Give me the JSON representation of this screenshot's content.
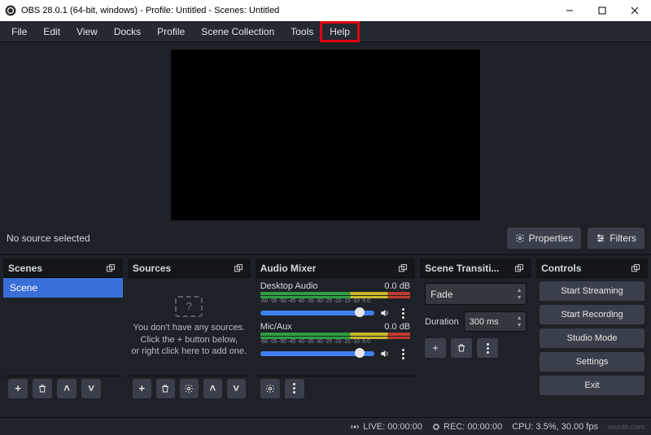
{
  "window": {
    "title": "OBS 28.0.1 (64-bit, windows) - Profile: Untitled - Scenes: Untitled"
  },
  "menu": {
    "file": "File",
    "edit": "Edit",
    "view": "View",
    "docks": "Docks",
    "profile": "Profile",
    "scene_collection": "Scene Collection",
    "tools": "Tools",
    "help": "Help"
  },
  "preview": {
    "no_source": "No source selected",
    "properties": "Properties",
    "filters": "Filters"
  },
  "scenes": {
    "title": "Scenes",
    "items": [
      "Scene"
    ]
  },
  "sources": {
    "title": "Sources",
    "hint1": "You don't have any sources.",
    "hint2": "Click the + button below,",
    "hint3": "or right click here to add one."
  },
  "mixer": {
    "title": "Audio Mixer",
    "ticks": "-60 -55 -50 -45 -40 -35 -30 -25 -20 -15 -10 -5 0",
    "channels": [
      {
        "name": "Desktop Audio",
        "level": "0.0 dB"
      },
      {
        "name": "Mic/Aux",
        "level": "0.0 dB"
      }
    ]
  },
  "transitions": {
    "title": "Scene Transiti...",
    "selected": "Fade",
    "duration_label": "Duration",
    "duration_value": "300 ms"
  },
  "controls": {
    "title": "Controls",
    "buttons": {
      "start_streaming": "Start Streaming",
      "start_recording": "Start Recording",
      "studio_mode": "Studio Mode",
      "settings": "Settings",
      "exit": "Exit"
    }
  },
  "status": {
    "live": "LIVE: 00:00:00",
    "rec": "REC: 00:00:00",
    "cpu": "CPU: 3.5%, 30.00 fps"
  },
  "icons": {
    "plus": "+",
    "question": "?"
  },
  "glyphs": {
    "up": "˄",
    "down": "˅",
    "updown": "⇵"
  }
}
